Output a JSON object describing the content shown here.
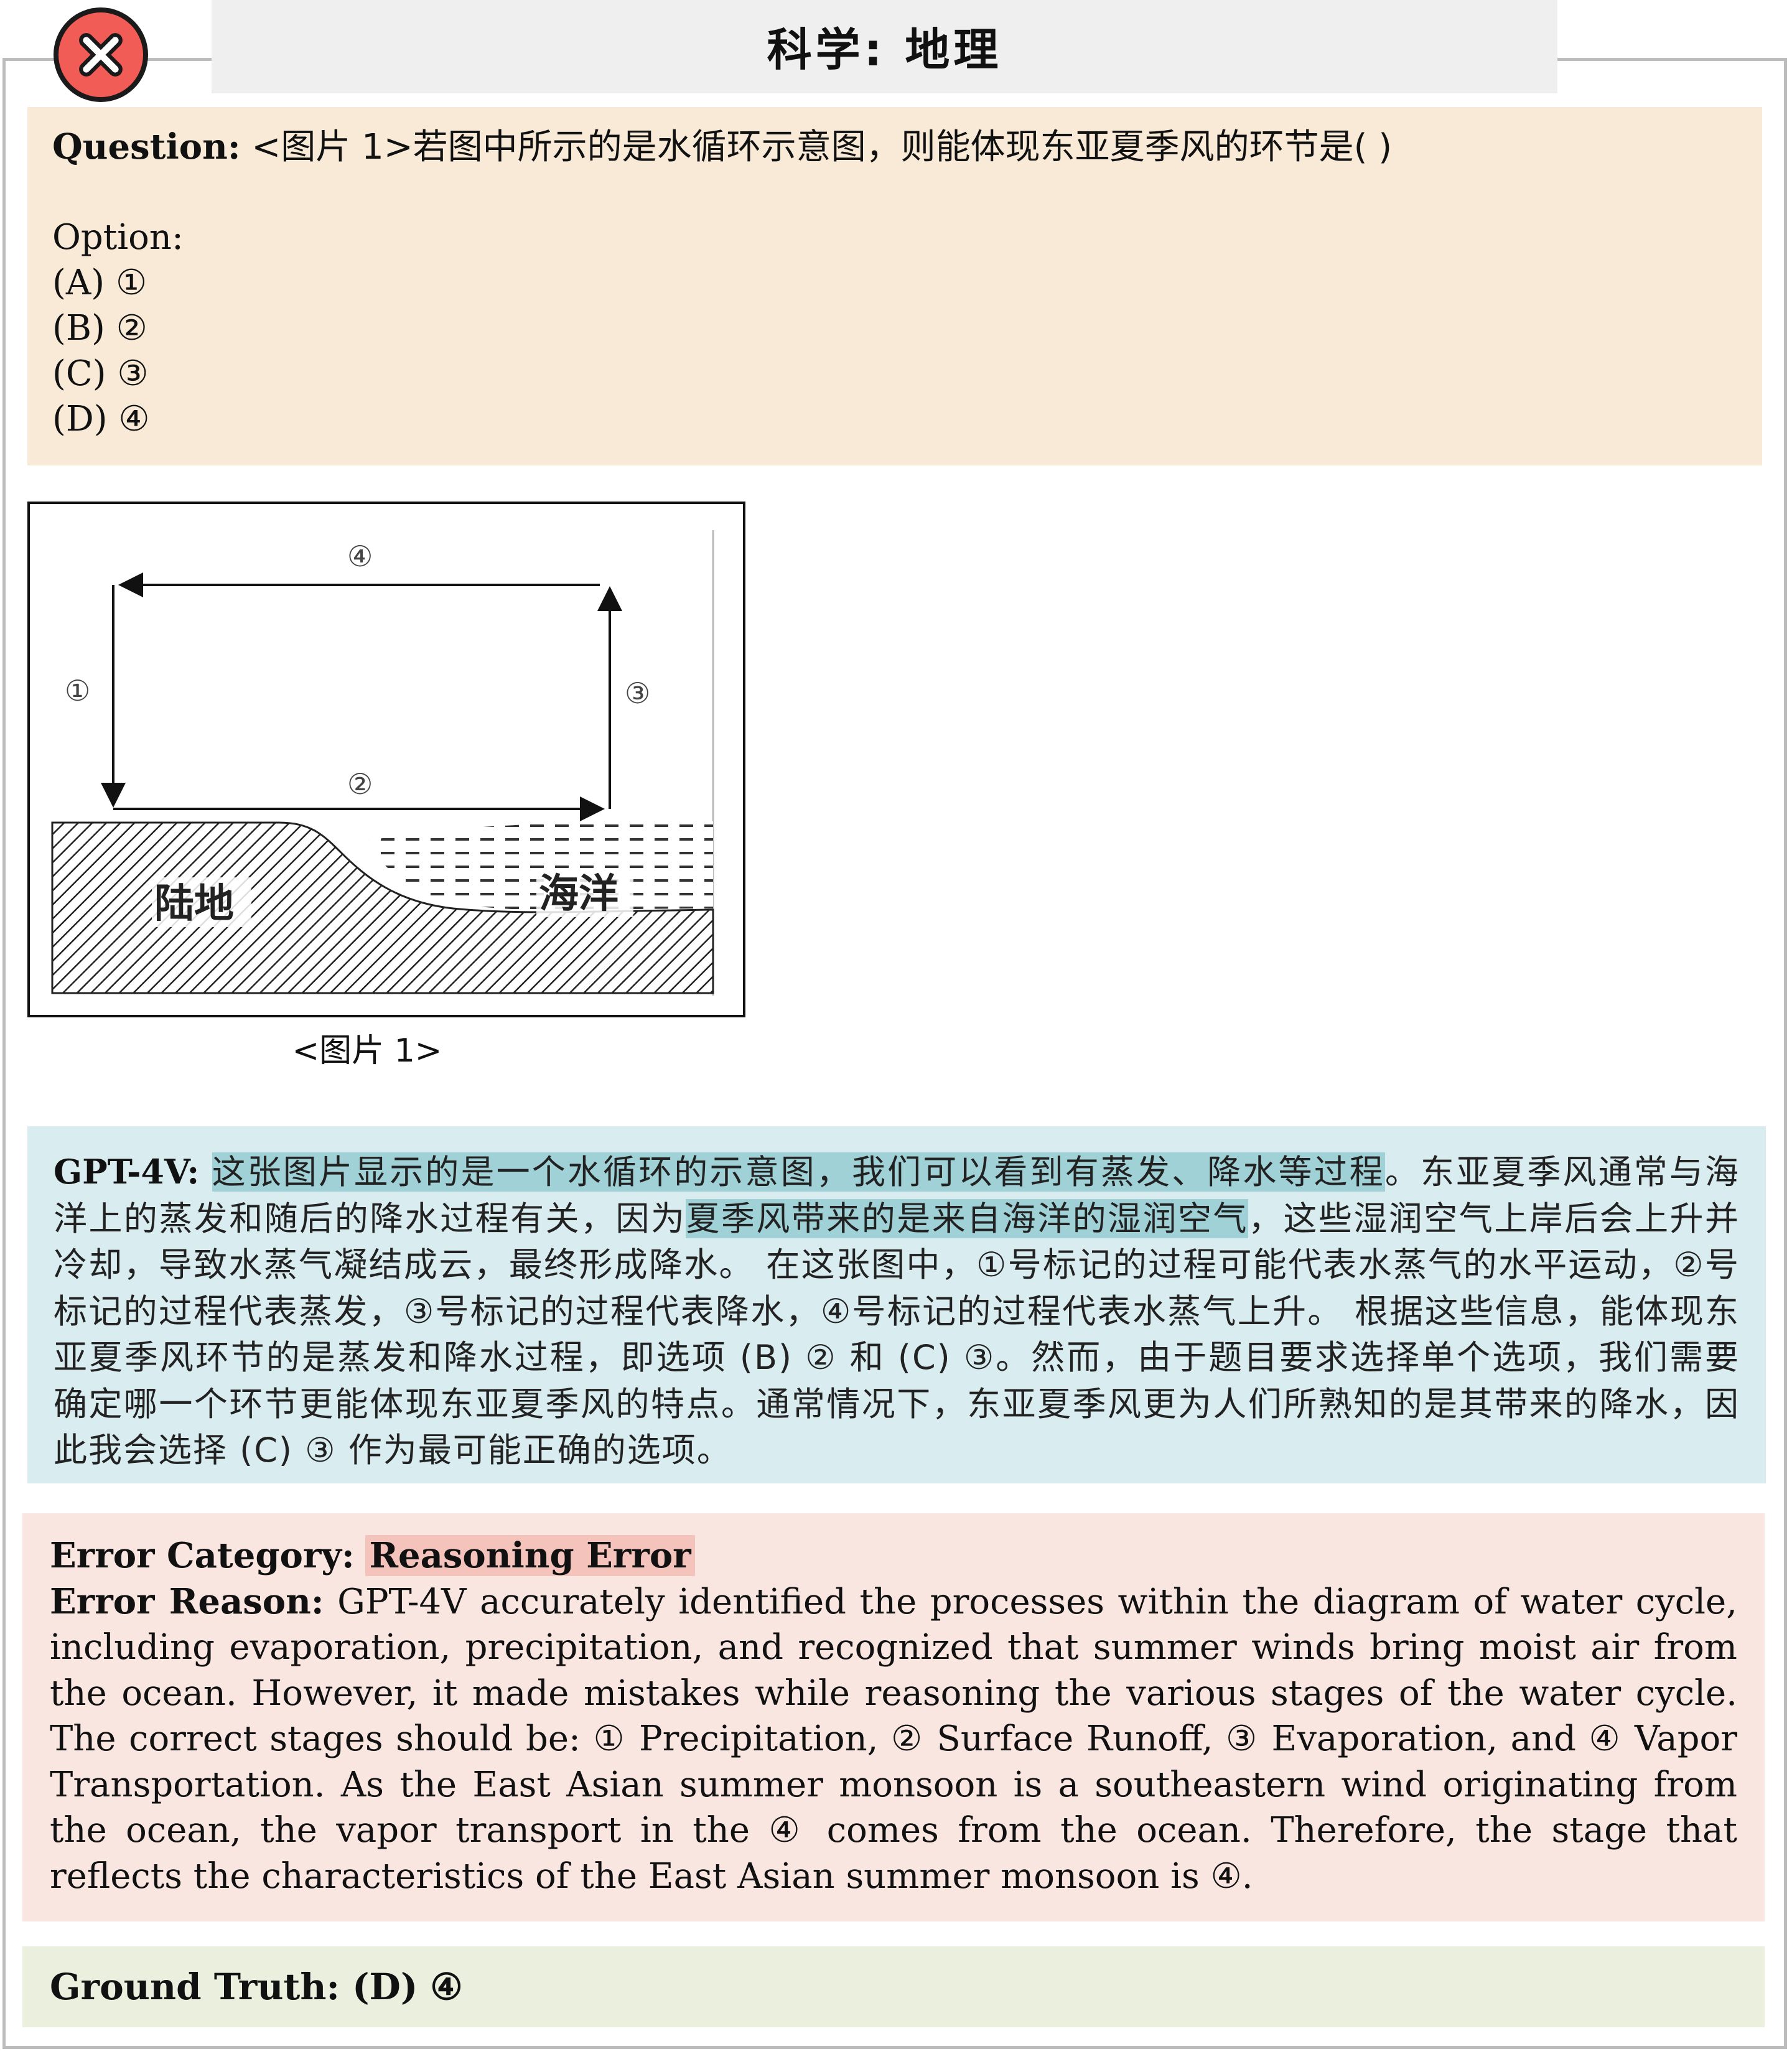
{
  "header": {
    "title": "科学: 地理",
    "status_icon": "close-icon"
  },
  "question": {
    "label": "Question:",
    "text": "<图片 1>若图中所示的是水循环示意图，则能体现东亚夏季风的环节是( )",
    "option_label": "Option:",
    "options": [
      "(A) ①",
      "(B) ②",
      "(C) ③",
      "(D) ④"
    ]
  },
  "figure": {
    "caption": "<图片 1>",
    "labels": {
      "arrow_1": "①",
      "arrow_2": "②",
      "arrow_3": "③",
      "arrow_4": "④",
      "land": "陆地",
      "ocean": "海洋"
    }
  },
  "gpt": {
    "label": "GPT-4V:",
    "hl1": "这张图片显示的是一个水循环的示意图，我们可以看到有蒸发、降水等过程",
    "text1": "。东亚夏季风通常与海洋上的蒸发和随后的降水过程有关，因为",
    "hl2": "夏季风带来的是来自海洋的湿润空气",
    "text2": "，这些湿润空气上岸后会上升并冷却，导致水蒸气凝结成云，最终形成降水。 在这张图中，①号标记的过程可能代表水蒸气的水平运动，②号标记的过程代表蒸发，③号标记的过程代表降水，④号标记的过程代表水蒸气上升。 根据这些信息，能体现东亚夏季风环节的是蒸发和降水过程，即选项 (B) ② 和 (C) ③。然而，由于题目要求选择单个选项，我们需要确定哪一个环节更能体现东亚夏季风的特点。通常情况下，东亚夏季风更为人们所熟知的是其带来的降水，因此我会选择 (C) ③ 作为最可能正确的选项。"
  },
  "error": {
    "category_label": "Error Category:",
    "category": "Reasoning Error",
    "reason_label": "Error Reason:",
    "reason": "GPT-4V accurately identified the processes within the diagram of water cycle, including evaporation, precipitation, and recognized that summer winds bring moist air from the ocean. However, it made mistakes while reasoning the various stages of the water cycle. The correct stages should be: ① Precipitation, ② Surface Runoff, ③ Evaporation, and ④ Vapor Transportation. As the East Asian summer monsoon is a southeastern wind originating from the ocean, the vapor transport in the ④ comes from the ocean. Therefore, the stage that reflects the characteristics of the East Asian summer monsoon is ④."
  },
  "ground_truth": {
    "label": "Ground Truth:",
    "value": "(D) ④"
  }
}
